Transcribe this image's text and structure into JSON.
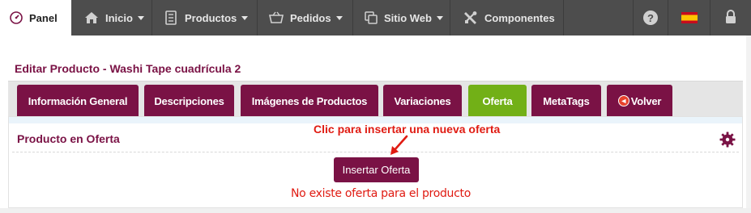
{
  "nav": {
    "panel": "Panel",
    "inicio": "Inicio",
    "productos": "Productos",
    "pedidos": "Pedidos",
    "sitio_web": "Sitio Web",
    "componentes": "Componentes"
  },
  "page": {
    "title": "Editar Producto - Washi Tape cuadrícula 2"
  },
  "tabs": [
    {
      "label": "Información General"
    },
    {
      "label": "Descripciones"
    },
    {
      "label": "Imágenes de Productos"
    },
    {
      "label": "Variaciones"
    },
    {
      "label": "Oferta"
    },
    {
      "label": "MetaTags"
    },
    {
      "label": "Volver"
    }
  ],
  "panel": {
    "title": "Producto en Oferta",
    "annotation": "Clic para insertar una nueva oferta",
    "insert_button": "Insertar Oferta",
    "empty_message": "No existe oferta para el producto"
  },
  "colors": {
    "brand": "#7a1245",
    "active_tab": "#72b017",
    "alert_text": "#e01b12",
    "topbar": "#4d4d4d"
  }
}
